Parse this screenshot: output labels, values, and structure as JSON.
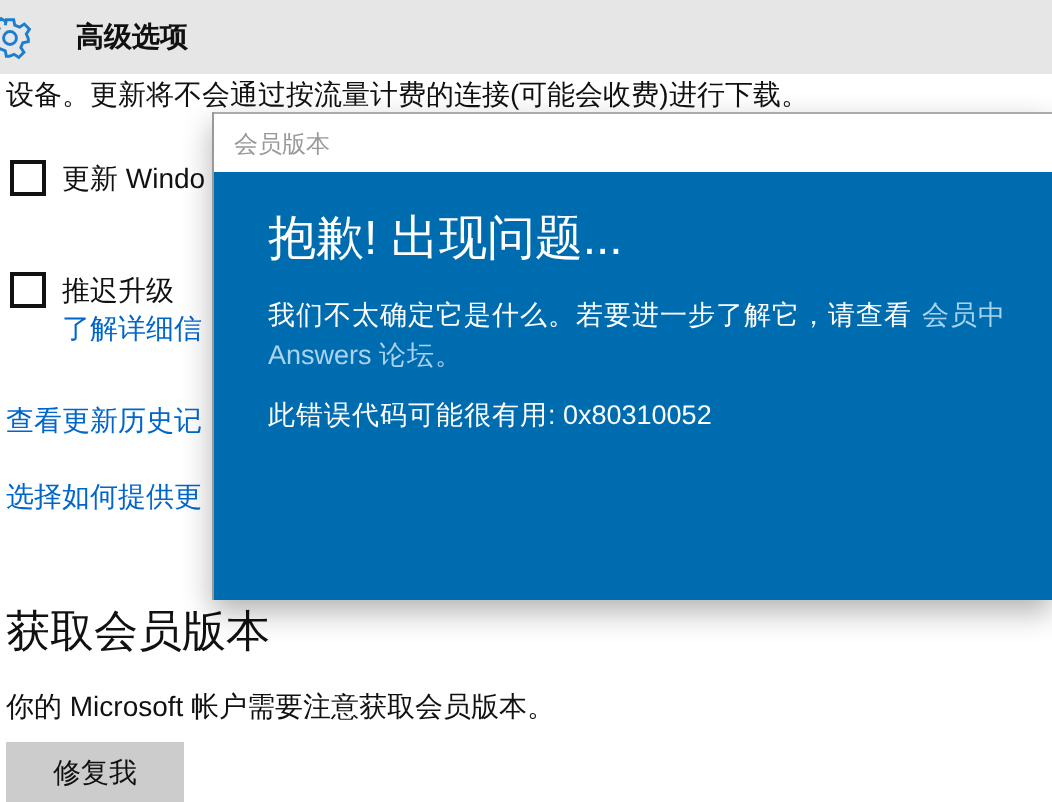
{
  "header": {
    "title": "高级选项"
  },
  "note": "设备。更新将不会通过按流量计费的连接(可能会收费)进行下载。",
  "options": [
    {
      "label": "更新 Windo",
      "checked": false
    },
    {
      "label": "推迟升级",
      "checked": false,
      "link": "了解详细信"
    }
  ],
  "links": [
    "查看更新历史记",
    "选择如何提供更"
  ],
  "section": {
    "heading": "获取会员版本",
    "text": "你的 Microsoft 帐户需要注意获取会员版本。",
    "button": "修复我"
  },
  "dialog": {
    "title": "会员版本",
    "heading": "抱歉! 出现问题...",
    "message": "我们不太确定它是什么。若要进一步了解它，请查看",
    "link_start": "会员中",
    "link_end": "Answers 论坛。",
    "error": "此错误代码可能很有用: 0x80310052"
  }
}
